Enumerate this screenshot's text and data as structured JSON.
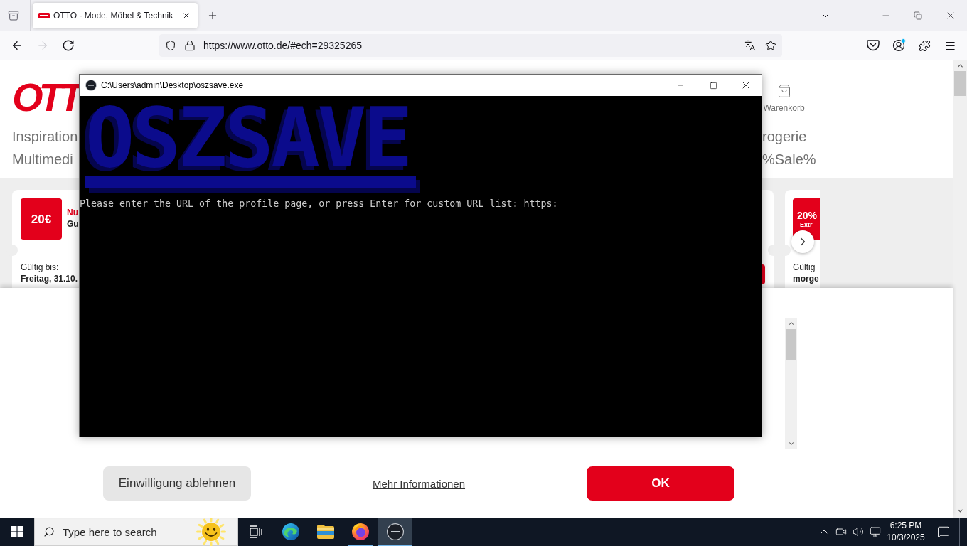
{
  "browser": {
    "tabs": [
      {
        "title": "OTTO - Mode, Möbel & Technik",
        "selected": true
      }
    ],
    "nav_buttons": [
      {
        "kind": "back",
        "disabled": false
      },
      {
        "kind": "forward",
        "disabled": true
      },
      {
        "kind": "reload",
        "disabled": false
      }
    ],
    "address_bar": {
      "url": "https://www.otto.de/#ech=29325265"
    },
    "account": {
      "notification": true
    }
  },
  "page": {
    "logo": "OTT",
    "cart_label": "Warenkorb",
    "nav_left": [
      "Inspiration",
      "Multimedi"
    ],
    "nav_right": [
      "rogerie",
      "%Sale%"
    ],
    "left_coupon": {
      "badge": "20€",
      "tag": "Nu",
      "title": "Gu",
      "valid_label": "Gültig bis:",
      "valid_date": "Freitag, 31.10."
    },
    "right_coupon": {
      "badge": "20%",
      "badge_sub": "Extr",
      "valid_label": "Gültig",
      "valid_date": "morge"
    }
  },
  "cookie_banner": {
    "buttons": [
      {
        "kind": "secondary",
        "label": "Einwilligung ablehnen"
      },
      {
        "kind": "link",
        "label": "Mehr Informationen"
      },
      {
        "kind": "primary",
        "label": "OK"
      }
    ]
  },
  "console": {
    "title": "C:\\Users\\admin\\Desktop\\oszsave.exe",
    "banner": "OSZSAVE",
    "lines": [
      "Please enter the URL of the profile page, or press Enter for custom URL list: https:"
    ]
  },
  "taskbar": {
    "search": {
      "placeholder": "Type here to search"
    },
    "apps": [
      {
        "kind": "task-view",
        "running": false,
        "selected": false
      },
      {
        "kind": "edge",
        "running": false,
        "selected": false
      },
      {
        "kind": "explorer",
        "running": false,
        "selected": false
      },
      {
        "kind": "firefox",
        "running": true,
        "selected": false
      },
      {
        "kind": "console",
        "running": true,
        "selected": true
      }
    ],
    "clock": {
      "time": "6:25 PM",
      "date": "10/3/2025"
    }
  }
}
